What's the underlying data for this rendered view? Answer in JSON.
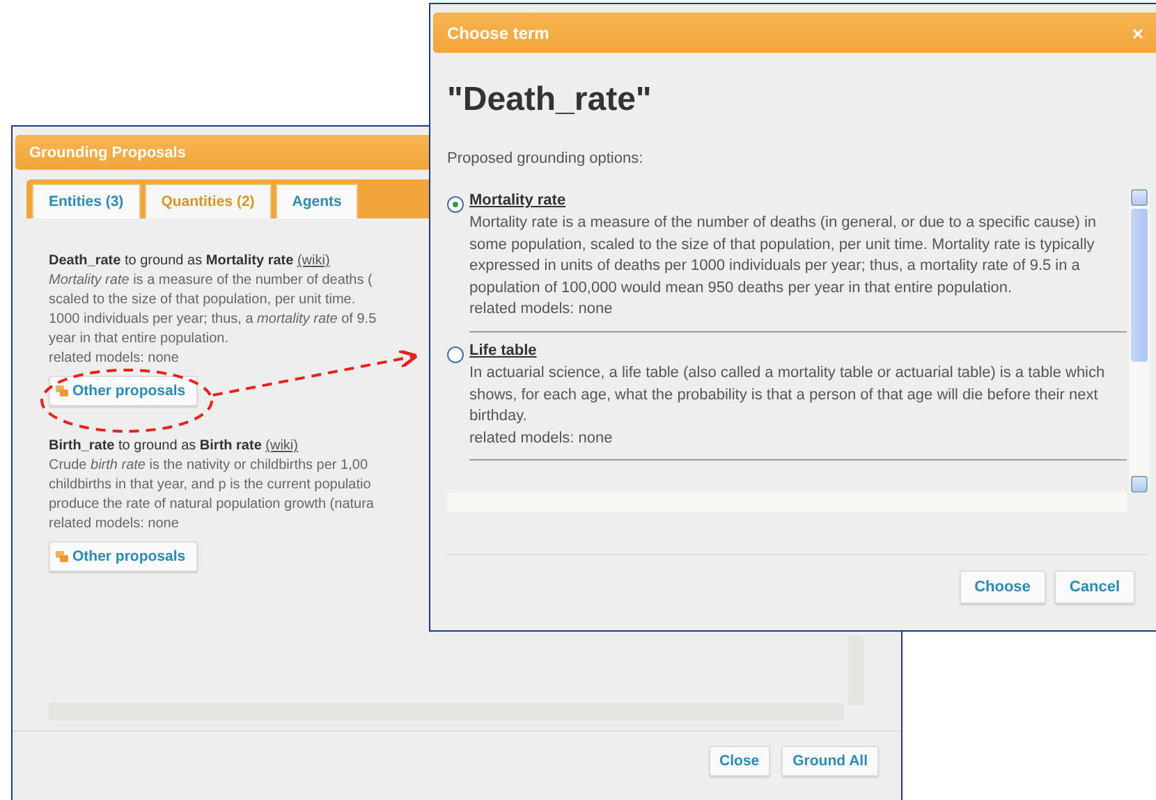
{
  "back_window": {
    "title": "Grounding Proposals",
    "tabs": [
      {
        "label": "Entities (3)",
        "selected": false
      },
      {
        "label": "Quantities (2)",
        "selected": true
      },
      {
        "label": "Agents",
        "selected": false
      }
    ],
    "proposals": [
      {
        "term": "Death_rate",
        "connector": "to ground as",
        "grounding": "Mortality rate",
        "link": "(wiki)",
        "description_lines": [
          "*Mortality rate* is a measure of the number of deaths (",
          "scaled to the size of that population, per unit time.",
          "1000 individuals per year; thus, a *mortality rate* of 9.5",
          "year in that entire population."
        ],
        "related": "related models: none",
        "button": "Other proposals"
      },
      {
        "term": "Birth_rate",
        "connector": "to ground as",
        "grounding": "Birth rate",
        "link": "(wiki)",
        "description_lines": [
          "Crude *birth rate* is the nativity or childbirths per 1,00",
          "childbirths in that year, and p is the current populatio",
          "produce the rate of natural population growth (natura"
        ],
        "related": "related models: none",
        "button": "Other proposals"
      }
    ],
    "buttons": [
      "Close",
      "Ground All"
    ]
  },
  "front_window": {
    "title": "Choose term",
    "close": "×",
    "heading": "\"Death_rate\"",
    "prompt": "Proposed grounding options:",
    "options": [
      {
        "title": "Mortality rate",
        "selected": true,
        "description": "Mortality rate is a measure of the number of deaths (in general, or due to a specific cause) in some population, scaled to the size of that population, per unit time. Mortality rate is typically expressed in units of deaths per 1000 individuals per year; thus, a mortality rate of 9.5 in a population of 100,000 would mean 950 deaths per year in that entire population.",
        "related": "related models: none"
      },
      {
        "title": "Life table",
        "selected": false,
        "description": "In actuarial science, a life table (also called a mortality table or actuarial table) is a table which shows, for each age, what the probability is that a person of that age will die before their next birthday.",
        "related": "related models: none"
      }
    ],
    "buttons": [
      "Choose",
      "Cancel"
    ]
  }
}
